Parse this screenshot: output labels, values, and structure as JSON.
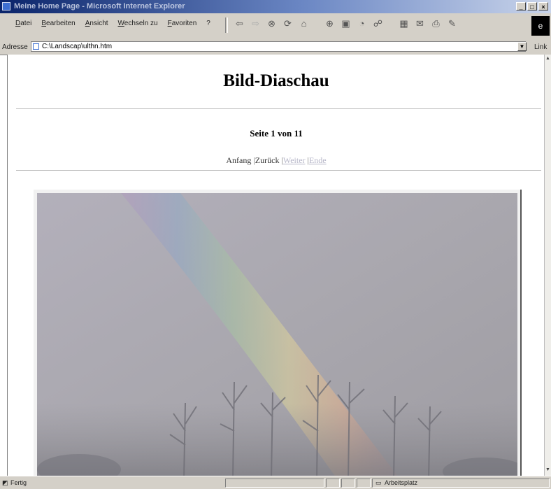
{
  "window": {
    "title": "Meine Home Page - Microsoft Internet Explorer"
  },
  "menu": {
    "items": [
      "Datei",
      "Bearbeiten",
      "Ansicht",
      "Wechseln zu",
      "Favoriten",
      "?"
    ]
  },
  "toolbar": {
    "icons": [
      "back-arrow-icon",
      "forward-arrow-icon",
      "stop-icon",
      "refresh-icon",
      "home-icon",
      "search-icon",
      "favorites-icon",
      "history-icon",
      "channels-icon",
      "fullscreen-icon",
      "mail-icon",
      "print-icon",
      "edit-icon"
    ]
  },
  "address": {
    "label": "Adresse",
    "value": "C:\\Landscap\\ulthn.htm",
    "links_label": "Link"
  },
  "page": {
    "title": "Bild-Diaschau",
    "counter": "Seite 1 von 11",
    "nav": {
      "first": "Anfang",
      "back": "Zurück",
      "next": "Weiter",
      "last": "Ende"
    }
  },
  "status": {
    "left": "Fertig",
    "zone": "Arbeitsplatz"
  }
}
